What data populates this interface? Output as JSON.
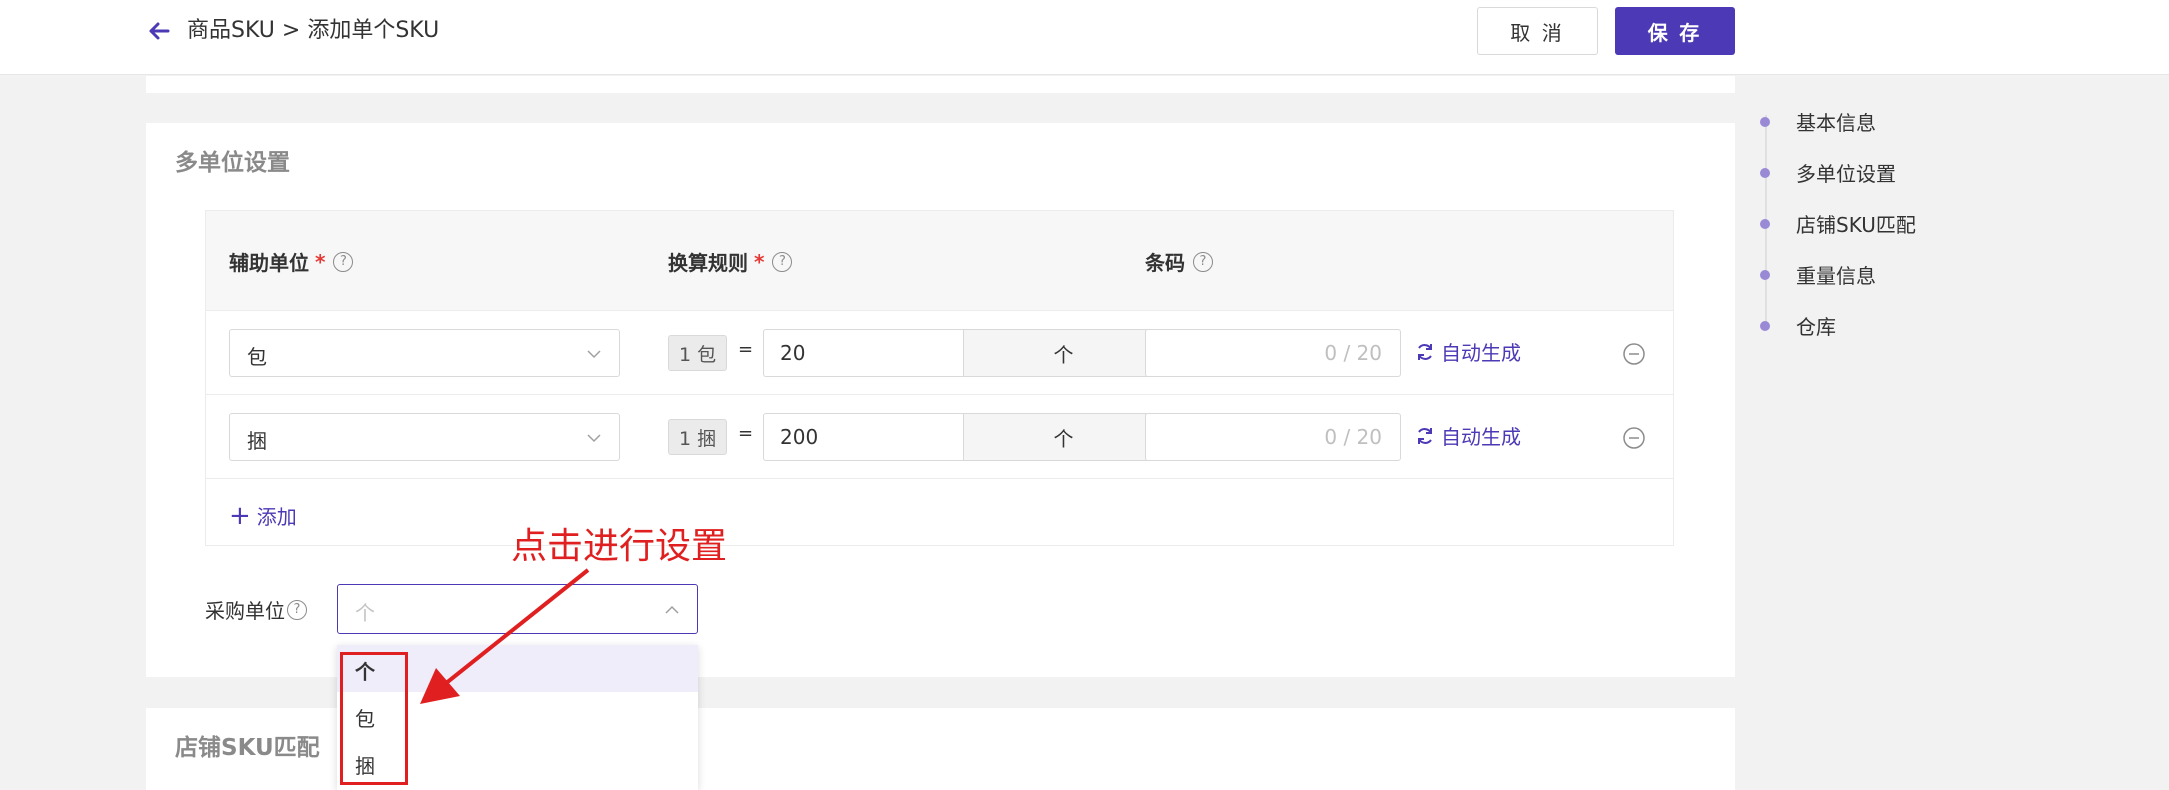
{
  "header": {
    "breadcrumb": "商品SKU > 添加单个SKU",
    "cancel_label": "取 消",
    "save_label": "保 存",
    "accent_color": "#4b39b5"
  },
  "multi_unit": {
    "title": "多单位设置",
    "columns": {
      "aux_unit": "辅助单位",
      "conversion": "换算规则",
      "barcode": "条码",
      "required_mark": "*",
      "help_mark": "?"
    },
    "rows": [
      {
        "unit": "包",
        "qty_tag": "1 包",
        "equals": "=",
        "quantity": "20",
        "base_unit": "个",
        "barcode_count": "0 / 20",
        "auto_generate": "自动生成"
      },
      {
        "unit": "捆",
        "qty_tag": "1 捆",
        "equals": "=",
        "quantity": "200",
        "base_unit": "个",
        "barcode_count": "0 / 20",
        "auto_generate": "自动生成"
      }
    ],
    "add_label": "添加",
    "add_icon": "+"
  },
  "purchase": {
    "label": "采购单位",
    "placeholder": "个",
    "options": [
      "个",
      "包",
      "捆"
    ],
    "selected": "个"
  },
  "annotation": {
    "text": "点击进行设置",
    "color": "#e02020"
  },
  "store_sku": {
    "title": "店铺SKU匹配"
  },
  "anchor_nav": {
    "items": [
      "基本信息",
      "多单位设置",
      "店铺SKU匹配",
      "重量信息",
      "仓库"
    ]
  }
}
